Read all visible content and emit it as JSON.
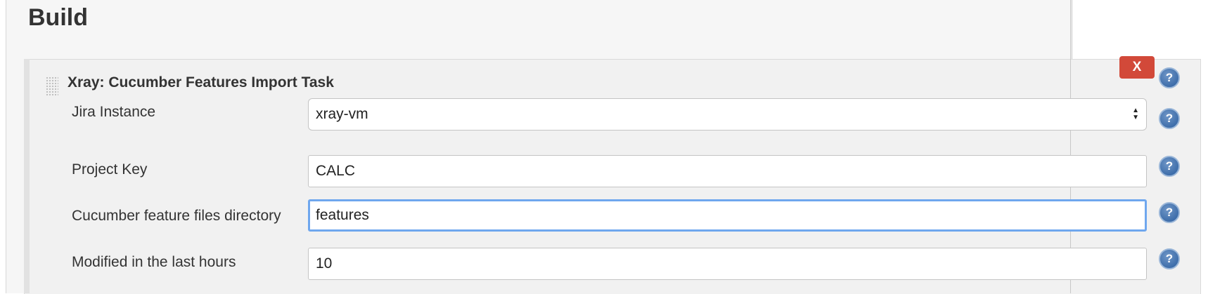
{
  "section": {
    "title": "Build"
  },
  "step": {
    "title": "Xray: Cucumber Features Import Task",
    "delete_label": "X",
    "fields": [
      {
        "label": "Jira Instance",
        "value": "xray-vm",
        "type": "select"
      },
      {
        "label": "Project Key",
        "value": "CALC",
        "type": "text"
      },
      {
        "label": "Cucumber feature files directory",
        "value": "features",
        "type": "text",
        "focused": true
      },
      {
        "label": "Modified in the last hours",
        "value": "10",
        "type": "text"
      }
    ]
  },
  "help_icon": "question-mark-icon",
  "colors": {
    "delete": "#d24939",
    "focus": "#6fa7ee",
    "help": "#2a5d9e"
  }
}
